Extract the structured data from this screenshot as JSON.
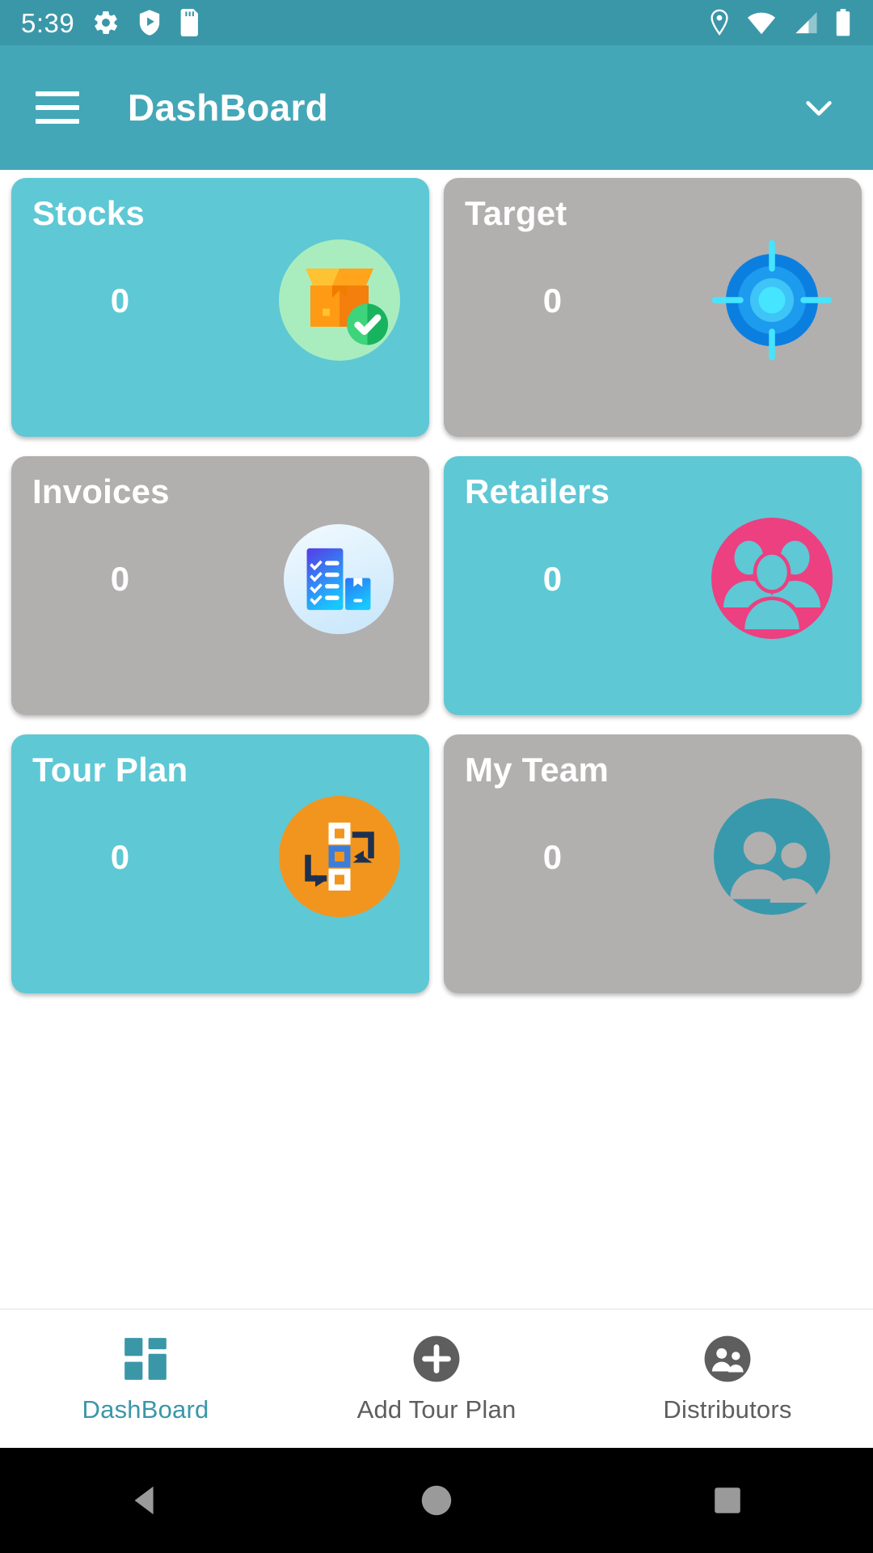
{
  "status_bar": {
    "time": "5:39",
    "left_icons": [
      "settings-gear-icon",
      "play-protect-shield-icon",
      "sd-card-icon"
    ],
    "right_icons": [
      "location-pin-icon",
      "wifi-icon",
      "cellular-signal-icon",
      "battery-full-icon"
    ],
    "background_color": "#3A97A8"
  },
  "app_bar": {
    "menu_icon": "hamburger-menu-icon",
    "title": "DashBoard",
    "dropdown_icon": "chevron-down-icon",
    "background_color": "#44A7B7"
  },
  "cards": [
    {
      "title": "Stocks",
      "value": "0",
      "bg_color": "#5EC8D5",
      "icon": "box-check-icon"
    },
    {
      "title": "Target",
      "value": "0",
      "bg_color": "#B2AFAF",
      "icon": "target-crosshair-icon"
    },
    {
      "title": "Invoices",
      "value": "0",
      "bg_color": "#B2AFAF",
      "icon": "invoice-checklist-icon"
    },
    {
      "title": "Retailers",
      "value": "0",
      "bg_color": "#5EC8D5",
      "icon": "retailers-group-icon"
    },
    {
      "title": "Tour Plan",
      "value": "0",
      "bg_color": "#5EC8D5",
      "icon": "tour-plan-flowchart-icon"
    },
    {
      "title": "My Team",
      "value": "0",
      "bg_color": "#B2AFAF",
      "icon": "my-team-people-icon"
    }
  ],
  "bottom_nav": {
    "items": [
      {
        "label": "DashBoard",
        "icon": "dashboard-grid-icon",
        "active": true
      },
      {
        "label": "Add Tour Plan",
        "icon": "plus-circle-icon",
        "active": false
      },
      {
        "label": "Distributors",
        "icon": "distributors-icon",
        "active": false
      }
    ],
    "active_color": "#3A97A8",
    "inactive_color": "#5E5E5E"
  },
  "system_nav": {
    "buttons": [
      "back-triangle-icon",
      "home-circle-icon",
      "recents-square-icon"
    ],
    "background_color": "#000000"
  }
}
